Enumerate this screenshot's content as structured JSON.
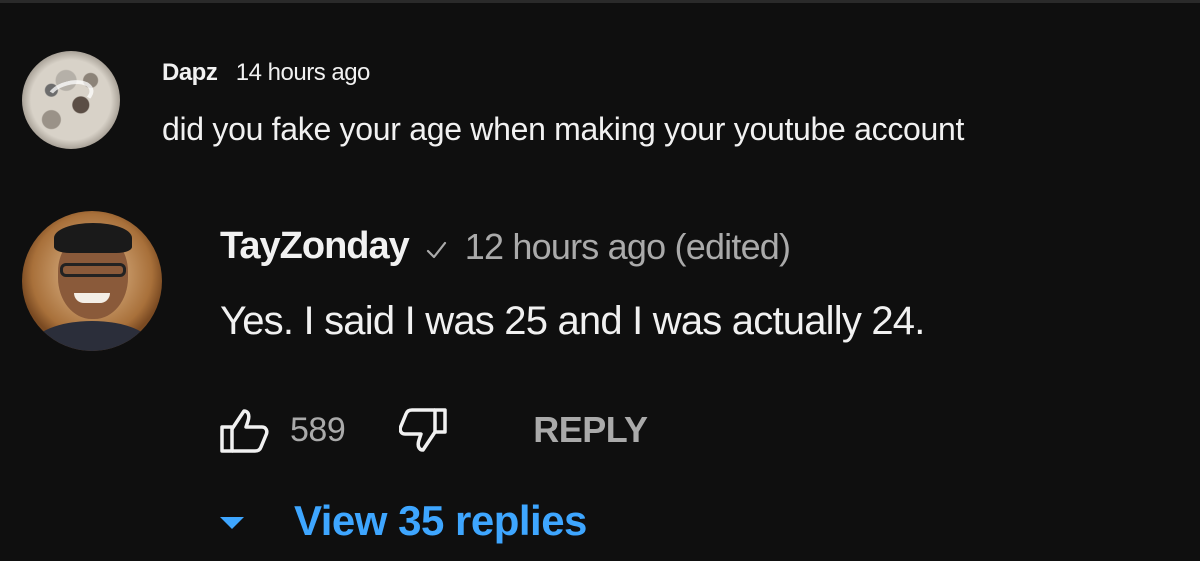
{
  "comment": {
    "author": "Dapz",
    "time": "14 hours ago",
    "text": "did you fake your age when making your youtube account"
  },
  "reply": {
    "author": "TayZonday",
    "verified": true,
    "time": "12 hours ago (edited)",
    "text": "Yes. I said I was 25 and I was actually 24.",
    "likes": "589",
    "reply_label": "REPLY"
  },
  "thread": {
    "view_replies_label": "View 35 replies"
  },
  "colors": {
    "background": "#0f0f0f",
    "primary_text": "#f1f1f1",
    "secondary_text": "#aaaaaa",
    "link_blue": "#3ea6ff"
  },
  "icons": {
    "like": "thumbs-up-icon",
    "dislike": "thumbs-down-icon",
    "verified": "checkmark-icon",
    "expand": "caret-down-icon"
  }
}
